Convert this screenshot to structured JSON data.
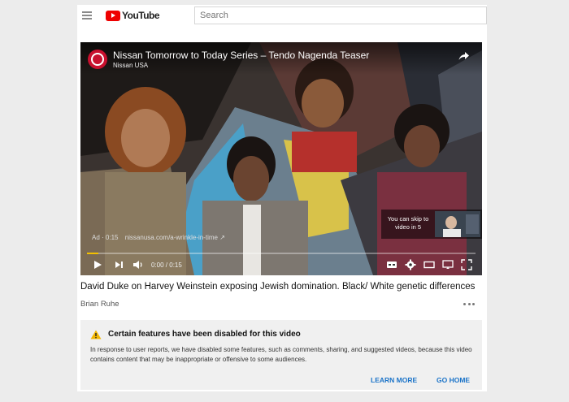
{
  "app": {
    "logo_text": "YouTube",
    "brand_color": "#ee0000"
  },
  "search": {
    "placeholder": "Search"
  },
  "player": {
    "video_title": "Nissan Tomorrow to Today Series – Tendo Nagenda Teaser",
    "channel": "Nissan USA",
    "ad_label": "Ad · 0:15",
    "ad_url": "nissanusa.com/a-wrinkle-in-time",
    "skip_text": "You can skip to video in 5",
    "time": "0:00 / 0:15",
    "progress": 0.03,
    "progress_color": "#f3c000"
  },
  "video": {
    "heading": "David Duke on Harvey Weinstein exposing Jewish domination. Black/ White genetic differences",
    "author": "Brian Ruhe"
  },
  "notice": {
    "title": "Certain features have been disabled for this video",
    "body": "In response to user reports, we have disabled some features, such as comments, sharing, and suggested videos, because this video contains content that may be inappropriate or offensive to some audiences.",
    "learn_more": "LEARN MORE",
    "go_home": "GO HOME",
    "link_color": "#1a73c8"
  }
}
